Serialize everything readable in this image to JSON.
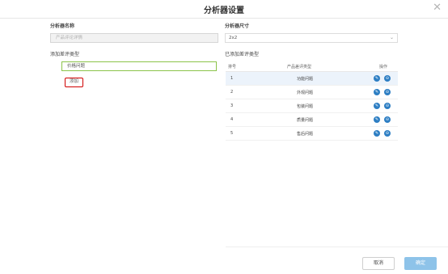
{
  "dialog": {
    "title": "分析器设置",
    "close_glyph": "✕"
  },
  "left": {
    "name_label": "分析器名称",
    "name_input_placeholder": "产品评论详情",
    "review_type_label": "添加差评类型",
    "review_type_value": "价格问题",
    "add_button": "添加"
  },
  "right": {
    "size_label": "分析器尺寸",
    "size_value": "2x2",
    "added_label": "已添加差评类型",
    "table": {
      "headers": [
        "排号",
        "产品差评类型",
        "操作"
      ],
      "rows": [
        {
          "no": "1",
          "type": "功能问题"
        },
        {
          "no": "2",
          "type": "外观问题"
        },
        {
          "no": "3",
          "type": "包装问题"
        },
        {
          "no": "4",
          "type": "质量问题"
        },
        {
          "no": "5",
          "type": "售后问题"
        }
      ]
    },
    "icons": {
      "edit": "edit-icon",
      "delete": "delete-icon"
    },
    "accent_color": "#2d7ec3"
  },
  "footer": {
    "cancel": "取消",
    "ok": "确定"
  }
}
